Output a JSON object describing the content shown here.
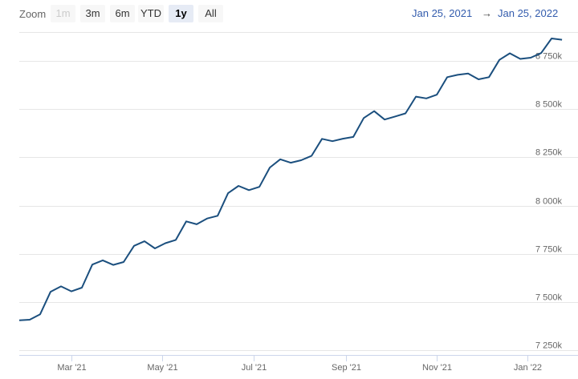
{
  "toolbar": {
    "zoom_label": "Zoom",
    "buttons": [
      {
        "label": "1m",
        "state": "disabled"
      },
      {
        "label": "3m",
        "state": "normal"
      },
      {
        "label": "6m",
        "state": "normal"
      },
      {
        "label": "YTD",
        "state": "normal"
      },
      {
        "label": "1y",
        "state": "selected"
      },
      {
        "label": "All",
        "state": "normal"
      }
    ],
    "from_date": "Jan 25, 2021",
    "arrow": "→",
    "to_date": "Jan 25, 2022"
  },
  "colors": {
    "line": "#1b4f7e",
    "grid": "#e6e6e6",
    "range_text": "#335cad",
    "selected_button": "#e6ebf5"
  },
  "chart_data": {
    "type": "line",
    "title": "",
    "xlabel": "",
    "ylabel": "",
    "xlim": [
      "2021-01-25",
      "2022-01-25"
    ],
    "ylim": [
      7225,
      8925
    ],
    "grid": true,
    "y_ticks": [
      7250,
      7500,
      7750,
      8000,
      8250,
      8500,
      8750
    ],
    "y_tick_labels": [
      "7 250k",
      "7 500k",
      "7 750k",
      "8 000k",
      "8 250k",
      "8 500k",
      "8 750k"
    ],
    "x_ticks": [
      "2021-03-01",
      "2021-05-01",
      "2021-07-01",
      "2021-09-01",
      "2021-11-01",
      "2022-01-01"
    ],
    "x_tick_labels": [
      "Mar '21",
      "May '21",
      "Jul '21",
      "Sep '21",
      "Nov '21",
      "Jan '22"
    ],
    "series": [
      {
        "x": [
          "2021-01-25",
          "2021-02-01",
          "2021-02-08",
          "2021-02-15",
          "2021-02-22",
          "2021-03-01",
          "2021-03-08",
          "2021-03-15",
          "2021-03-22",
          "2021-03-29",
          "2021-04-05",
          "2021-04-12",
          "2021-04-19",
          "2021-04-26",
          "2021-05-03",
          "2021-05-10",
          "2021-05-17",
          "2021-05-24",
          "2021-05-31",
          "2021-06-07",
          "2021-06-14",
          "2021-06-21",
          "2021-06-28",
          "2021-07-05",
          "2021-07-12",
          "2021-07-19",
          "2021-07-26",
          "2021-08-02",
          "2021-08-09",
          "2021-08-16",
          "2021-08-23",
          "2021-08-30",
          "2021-09-06",
          "2021-09-13",
          "2021-09-20",
          "2021-09-27",
          "2021-10-04",
          "2021-10-11",
          "2021-10-18",
          "2021-10-25",
          "2021-11-01",
          "2021-11-08",
          "2021-11-15",
          "2021-11-22",
          "2021-11-29",
          "2021-12-06",
          "2021-12-13",
          "2021-12-20",
          "2021-12-27",
          "2022-01-03",
          "2022-01-10",
          "2022-01-17",
          "2022-01-24"
        ],
        "values": [
          7405,
          7408,
          7436,
          7553,
          7581,
          7555,
          7574,
          7694,
          7716,
          7692,
          7707,
          7791,
          7815,
          7778,
          7805,
          7822,
          7918,
          7903,
          7933,
          7947,
          8064,
          8102,
          8080,
          8097,
          8197,
          8240,
          8222,
          8235,
          8258,
          8346,
          8334,
          8347,
          8356,
          8454,
          8490,
          8446,
          8462,
          8478,
          8565,
          8556,
          8575,
          8666,
          8678,
          8685,
          8655,
          8666,
          8756,
          8790,
          8761,
          8767,
          8791,
          8867,
          8860
        ]
      }
    ]
  }
}
